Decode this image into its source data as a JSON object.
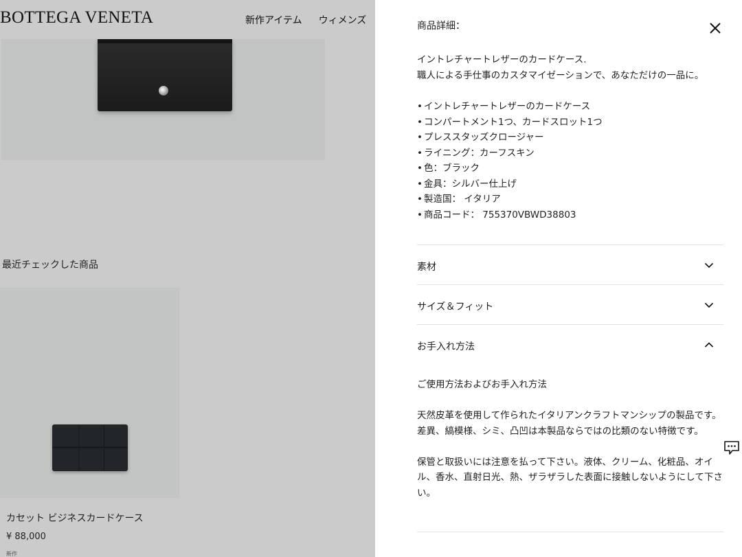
{
  "header": {
    "brand": "BOTTEGA VENETA",
    "nav": [
      "新作アイテム",
      "ウィメンズ"
    ]
  },
  "recent": {
    "title": "最近チェックした商品",
    "item": {
      "name": "カセット ビジネスカードケース",
      "price": "¥ 88,000",
      "small_text": "新作"
    }
  },
  "drawer": {
    "title": "商品詳細：",
    "close_icon": "close-icon",
    "description": [
      "イントレチャートレザーのカードケース.",
      "職人による手仕事のカスタマイゼーションで、あなただけの一品に。"
    ],
    "specs": [
      "イントレチャートレザーのカードケース",
      "コンパートメント1つ、カードスロット1つ",
      "プレススタッズクロージャー",
      "ライニング：カーフスキン",
      "色：ブラック",
      "金具：シルバー仕上げ",
      "製造国： イタリア",
      "商品コード： 755370VBWD38803"
    ],
    "accordion": [
      {
        "label": "素材",
        "icon": "chevron-down-icon",
        "expanded": false
      },
      {
        "label": "サイズ＆フィット",
        "icon": "chevron-down-icon",
        "expanded": false
      },
      {
        "label": "お手入れ方法",
        "icon": "chevron-up-icon",
        "expanded": true
      }
    ],
    "care": [
      "ご使用方法およびお手入れ方法",
      "天然皮革を使用して作られたイタリアンクラフトマンシップの製品です。差異、縞模様、シミ、凸凹は本製品ならではの比類のない特徴です。",
      "保管と取扱いには注意を払って下さい。液体、クリーム、化粧品、オイル、香水、直射日光、熱、ザラザラした表面に接触しないようにして下さい。"
    ]
  },
  "chat": {
    "icon": "chat-icon"
  },
  "colors": {
    "overlay_page": "#cbcbcb",
    "drawer_bg": "#ffffff",
    "text": "#222222",
    "divider": "#e3e3e3"
  }
}
